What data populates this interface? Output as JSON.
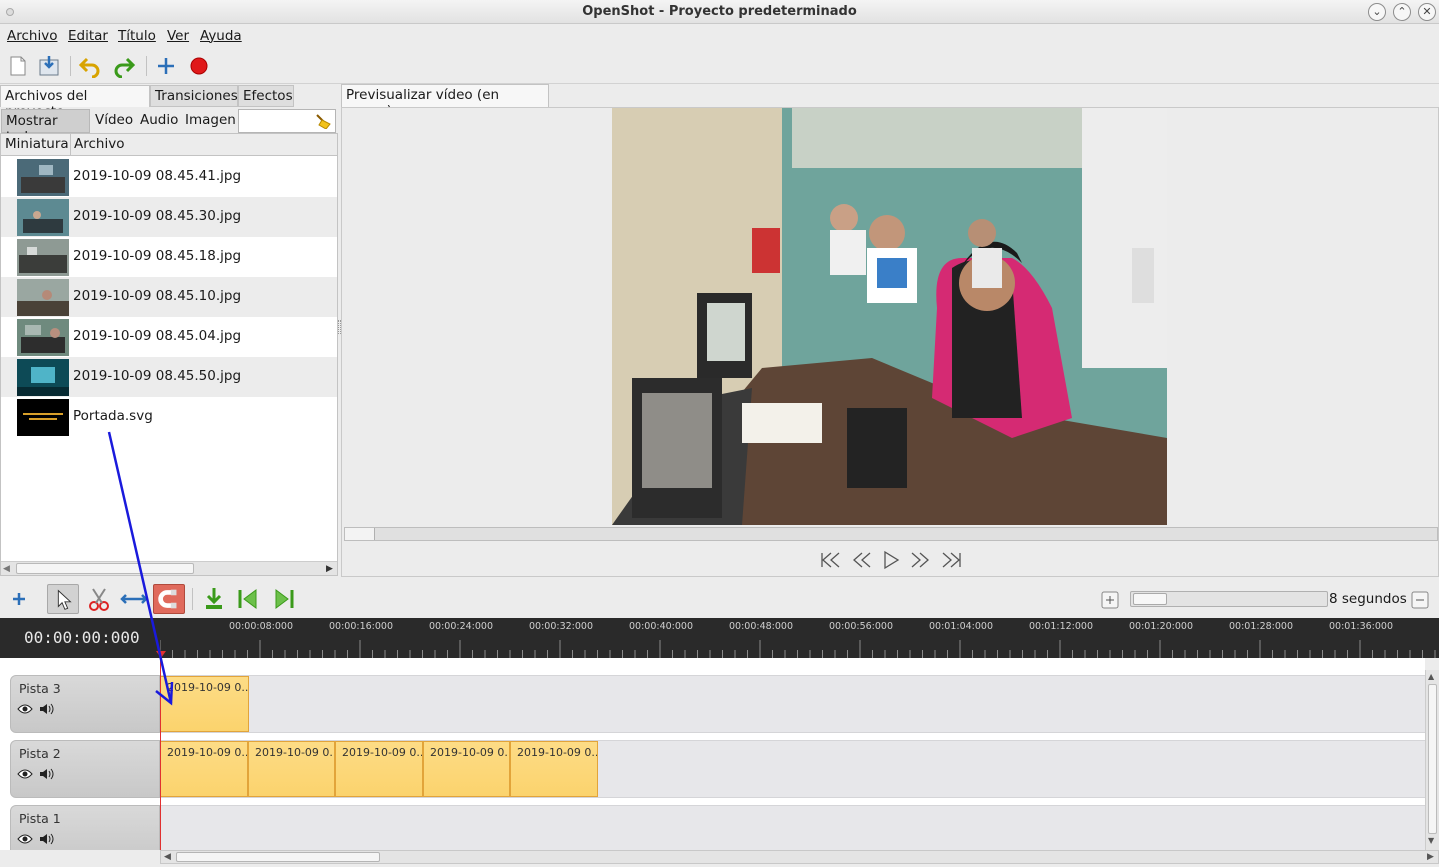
{
  "window": {
    "title": "OpenShot - Proyecto predeterminado"
  },
  "menu": [
    "Archivo",
    "Editar",
    "Título",
    "Ver",
    "Ayuda"
  ],
  "left_tabs": [
    "Archivos del proyecto",
    "Transiciones",
    "Efectos"
  ],
  "filters": {
    "show_all": "Mostrar todo",
    "video": "Vídeo",
    "audio": "Audio",
    "image": "Imagen",
    "search_value": ""
  },
  "files_table": {
    "columns": [
      "Miniatura",
      "Archivo"
    ],
    "rows": [
      "2019-10-09 08.45.41.jpg",
      "2019-10-09 08.45.30.jpg",
      "2019-10-09 08.45.18.jpg",
      "2019-10-09 08.45.10.jpg",
      "2019-10-09 08.45.04.jpg",
      "2019-10-09 08.45.50.jpg",
      "Portada.svg"
    ]
  },
  "preview": {
    "tab": "Previsualizar vídeo (en pausa)"
  },
  "timeline": {
    "zoom_label": "8 segundos",
    "current_time": "00:00:00:000",
    "ruler_ticks": [
      "00:00:08:000",
      "00:00:16:000",
      "00:00:24:000",
      "00:00:32:000",
      "00:00:40:000",
      "00:00:48:000",
      "00:00:56:000",
      "00:01:04:000",
      "00:01:12:000",
      "00:01:20:000",
      "00:01:28:000",
      "00:01:36:000"
    ],
    "tracks": [
      {
        "name": "Pista 3",
        "clips": [
          "2019-10-09 0..."
        ]
      },
      {
        "name": "Pista 2",
        "clips": [
          "2019-10-09 0...",
          "2019-10-09 0...",
          "2019-10-09 0...",
          "2019-10-09 0...",
          "2019-10-09 0..."
        ]
      },
      {
        "name": "Pista 1",
        "clips": []
      }
    ]
  },
  "colors": {
    "clip_fill": "#fbd36d",
    "clip_border": "#e2a43a",
    "ruler_bg": "#2a2a2a",
    "playhead": "#e03030",
    "annotation_arrow": "#1a1adc"
  }
}
